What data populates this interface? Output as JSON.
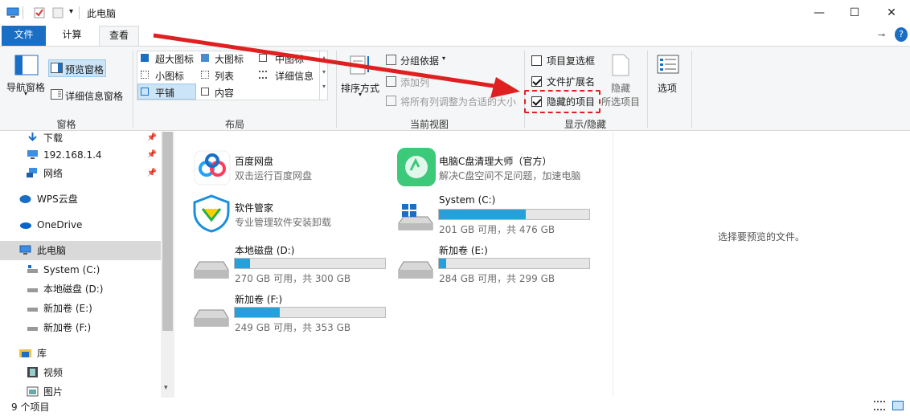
{
  "window": {
    "title": "此电脑"
  },
  "tabs": {
    "file": "文件",
    "computer": "计算机",
    "view": "查看"
  },
  "ribbon": {
    "pane": {
      "nav_pane": "导航窗格",
      "preview_pane": "预览窗格",
      "details_pane": "详细信息窗格",
      "group": "窗格"
    },
    "layout": {
      "extra_large": "超大图标",
      "large": "大图标",
      "medium": "中图标",
      "small": "小图标",
      "list": "列表",
      "details": "详细信息",
      "tiles": "平铺",
      "content": "内容",
      "group": "布局"
    },
    "current_view": {
      "sort_by": "排序方式",
      "group_by": "分组依据",
      "add_columns": "添加列",
      "size_columns": "将所有列调整为合适的大小",
      "group": "当前视图"
    },
    "show_hide": {
      "item_checkboxes": "项目复选框",
      "file_extensions": "文件扩展名",
      "hidden_items": "隐藏的项目",
      "hide_selected_1": "隐藏",
      "hide_selected_2": "所选项目",
      "group": "显示/隐藏"
    },
    "options": "选项"
  },
  "checkboxes": {
    "item_checkboxes": false,
    "file_extensions": true,
    "hidden_items": true
  },
  "nav": {
    "items": [
      {
        "label": "下载"
      },
      {
        "label": "192.168.1.4"
      },
      {
        "label": "网络"
      },
      {
        "label": "WPS云盘"
      },
      {
        "label": "OneDrive"
      },
      {
        "label": "此电脑"
      },
      {
        "label": "System (C:)"
      },
      {
        "label": "本地磁盘 (D:)"
      },
      {
        "label": "新加卷 (E:)"
      },
      {
        "label": "新加卷 (F:)"
      },
      {
        "label": "库"
      },
      {
        "label": "视频"
      },
      {
        "label": "图片"
      }
    ]
  },
  "content": {
    "apps": [
      {
        "name": "百度网盘",
        "desc": "双击运行百度网盘"
      },
      {
        "name": "电脑C盘清理大师（官方）",
        "desc": "解决C盘空间不足问题，加速电脑"
      },
      {
        "name": "软件管家",
        "desc": "专业管理软件安装卸载"
      }
    ],
    "drives": [
      {
        "name": "System (C:)",
        "info": "201 GB 可用，共 476 GB",
        "used_fraction": 0.58
      },
      {
        "name": "本地磁盘 (D:)",
        "info": "270 GB 可用，共 300 GB",
        "used_fraction": 0.1
      },
      {
        "name": "新加卷 (E:)",
        "info": "284 GB 可用，共 299 GB",
        "used_fraction": 0.05
      },
      {
        "name": "新加卷 (F:)",
        "info": "249 GB 可用，共 353 GB",
        "used_fraction": 0.3
      }
    ]
  },
  "preview": {
    "message": "选择要预览的文件。"
  },
  "status": {
    "count": "9 个项目"
  },
  "colors": {
    "accent": "#1a6fc4",
    "bar_fill": "#26a0da",
    "annotation": "#e02020"
  }
}
